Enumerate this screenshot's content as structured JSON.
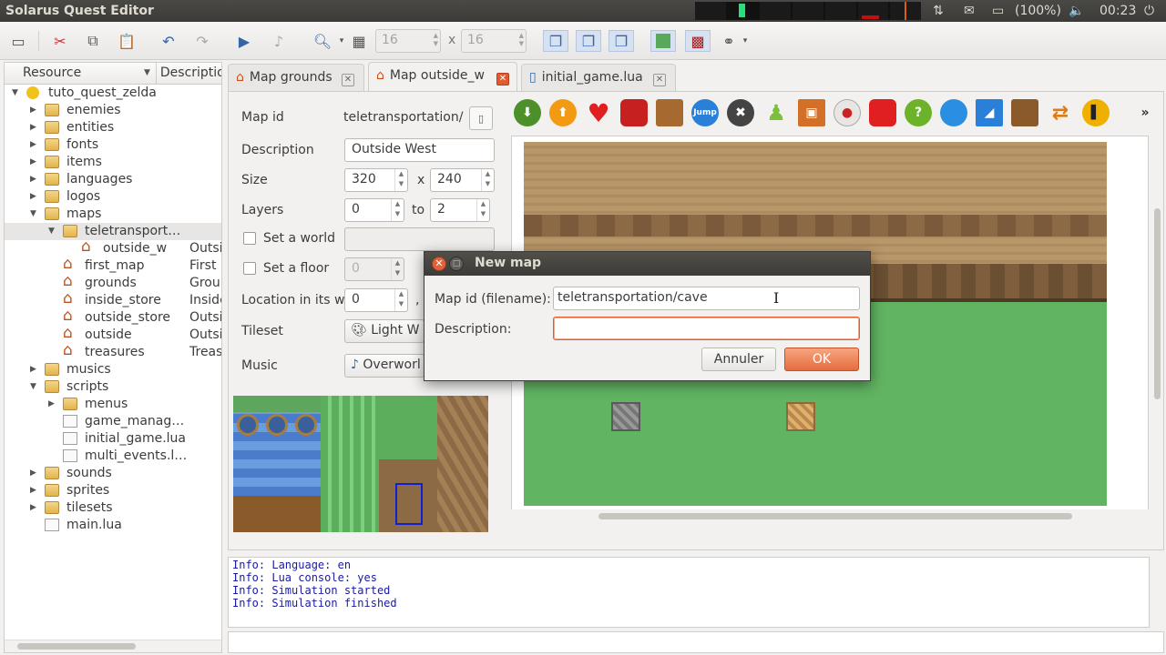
{
  "app": {
    "title": "Solarus Quest Editor"
  },
  "tray": {
    "battery": "(100%)",
    "clock": "00:23"
  },
  "toolbar": {
    "grid_w": "16",
    "grid_sep": "x",
    "grid_h": "16"
  },
  "tree": {
    "header_resource": "Resource",
    "header_desc": "Description",
    "rows": [
      {
        "label": "tuto_quest_zelda",
        "desc": ""
      },
      {
        "label": "enemies",
        "desc": ""
      },
      {
        "label": "entities",
        "desc": ""
      },
      {
        "label": "fonts",
        "desc": ""
      },
      {
        "label": "items",
        "desc": ""
      },
      {
        "label": "languages",
        "desc": ""
      },
      {
        "label": "logos",
        "desc": ""
      },
      {
        "label": "maps",
        "desc": ""
      },
      {
        "label": "teletransport…",
        "desc": ""
      },
      {
        "label": "outside_w",
        "desc": "Outside West"
      },
      {
        "label": "first_map",
        "desc": "First map"
      },
      {
        "label": "grounds",
        "desc": "Grounds"
      },
      {
        "label": "inside_store",
        "desc": "Inside store"
      },
      {
        "label": "outside_store",
        "desc": "Outside store"
      },
      {
        "label": "outside",
        "desc": "Outside"
      },
      {
        "label": "treasures",
        "desc": "Treasures"
      },
      {
        "label": "musics",
        "desc": ""
      },
      {
        "label": "scripts",
        "desc": ""
      },
      {
        "label": "menus",
        "desc": ""
      },
      {
        "label": "game_manag…",
        "desc": ""
      },
      {
        "label": "initial_game.lua",
        "desc": ""
      },
      {
        "label": "multi_events.l…",
        "desc": ""
      },
      {
        "label": "sounds",
        "desc": ""
      },
      {
        "label": "sprites",
        "desc": ""
      },
      {
        "label": "tilesets",
        "desc": ""
      },
      {
        "label": "main.lua",
        "desc": ""
      }
    ]
  },
  "tabs": [
    {
      "label": "Map grounds"
    },
    {
      "label": "Map outside_w"
    },
    {
      "label": "initial_game.lua"
    }
  ],
  "properties": {
    "map_id_label": "Map id",
    "map_id_value": "teletransportation/",
    "description_label": "Description",
    "description_value": "Outside West",
    "size_label": "Size",
    "size_w": "320",
    "size_x": "x",
    "size_h": "240",
    "layers_label": "Layers",
    "layers_from": "0",
    "layers_to_label": "to",
    "layers_to": "2",
    "set_world_label": "Set a world",
    "set_floor_label": "Set a floor",
    "floor_value": "0",
    "location_label": "Location in its w",
    "location_x": "0",
    "location_sep": ",",
    "tileset_label": "Tileset",
    "tileset_value": "Light W",
    "music_label": "Music",
    "music_value": "Overworl"
  },
  "entity_jump_label": "Jump",
  "console": {
    "lines": [
      "Info: Language: en",
      "Info: Lua console: yes",
      "Info: Simulation started",
      "Info: Simulation finished"
    ]
  },
  "dialog": {
    "title": "New map",
    "map_id_label": "Map id (filename):",
    "map_id_value": "teletransportation/cave",
    "description_label": "Description:",
    "description_value": "",
    "cancel_label": "Annuler",
    "ok_label": "OK"
  },
  "colors": {
    "accent": "#e05a32",
    "map_grass": "#61b462",
    "console_text": "#1a1aa0"
  }
}
